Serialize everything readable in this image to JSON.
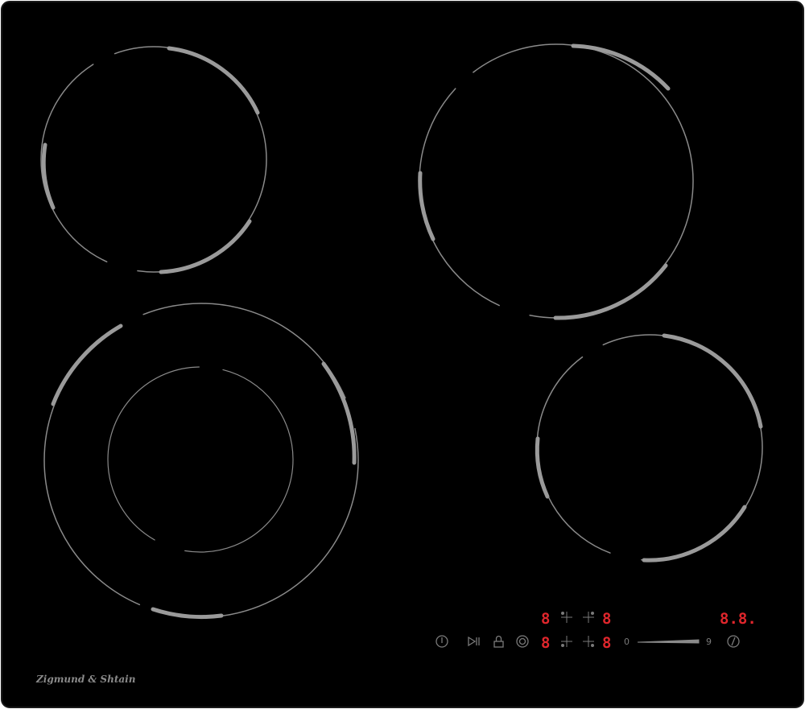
{
  "brand": {
    "name": "Zigmund & Shtain"
  },
  "colors": {
    "glass": "#000000",
    "frame": "#1a1a1a",
    "zone_line": "#8a8a8a",
    "zone_line_bright": "#a6a6a6",
    "control_icons": "#7a7a7a",
    "display_red": "#e0262c"
  },
  "controls": {
    "power_icon": "power-icon",
    "play_pause_icon": "play-pause-icon",
    "lock_icon": "lock-icon",
    "zone_select_icon": "zone-select-icon",
    "timer_icon": "timer-icon",
    "zone_displays": {
      "top_left": "8",
      "top_right": "8",
      "bottom_left": "8",
      "bottom_right": "8"
    },
    "timer_display": "8.8.",
    "slider_min": "0",
    "slider_max": "9"
  }
}
